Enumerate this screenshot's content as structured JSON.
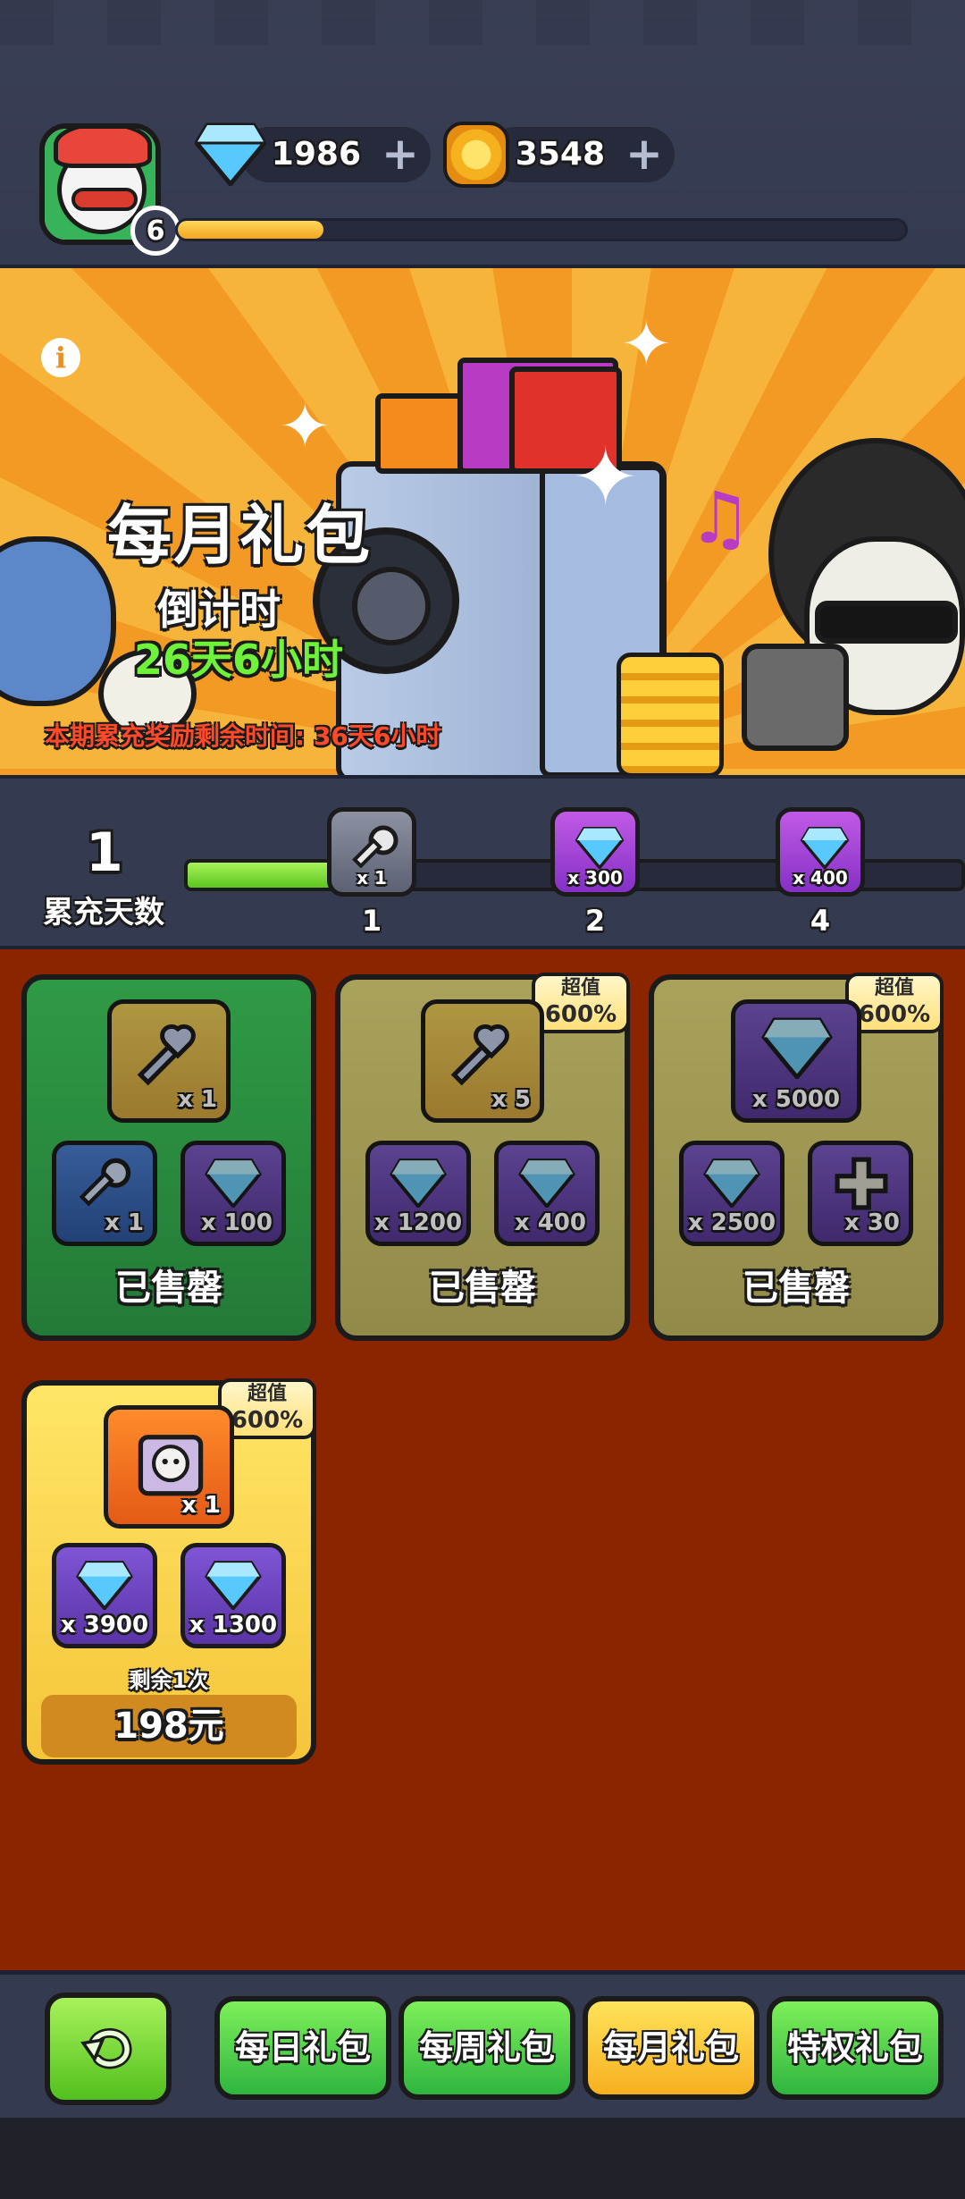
{
  "header": {
    "player_level": "6",
    "xp_progress": 0.2,
    "gems": "1986",
    "coins": "3548"
  },
  "banner": {
    "title": "每月礼包",
    "countdown_label": "倒计时",
    "countdown_value": "26天6小时",
    "period_text": "本期累充奖励剩余时间: 36天6小时"
  },
  "progress": {
    "days": "1",
    "days_label": "累充天数",
    "fill": 0.2,
    "milestones": [
      {
        "reward": "key-icon",
        "qty": "x 1",
        "day": "1"
      },
      {
        "reward": "gem-icon",
        "qty": "x 300",
        "day": "2"
      },
      {
        "reward": "gem-icon",
        "qty": "x 400",
        "day": "4"
      }
    ]
  },
  "packs": [
    {
      "main": {
        "icon": "heart-key-icon",
        "qty": "x 1"
      },
      "sub": [
        {
          "icon": "blue-key-icon",
          "qty": "x 1"
        },
        {
          "icon": "gem-icon",
          "qty": "x 100"
        }
      ],
      "badge": null,
      "status": "已售罄"
    },
    {
      "main": {
        "icon": "heart-key-icon",
        "qty": "x 5"
      },
      "sub": [
        {
          "icon": "gem-icon",
          "qty": "x 1200"
        },
        {
          "icon": "gem-icon",
          "qty": "x 400"
        }
      ],
      "badge": {
        "line1": "超值",
        "line2": "600%"
      },
      "status": "已售罄"
    },
    {
      "main": {
        "icon": "gem-icon",
        "qty": "x 5000"
      },
      "sub": [
        {
          "icon": "gem-icon",
          "qty": "x 2500"
        },
        {
          "icon": "cross-icon",
          "qty": "x 30"
        }
      ],
      "badge": {
        "line1": "超值",
        "line2": "600%"
      },
      "status": "已售罄"
    },
    {
      "main": {
        "icon": "sheep-box-icon",
        "qty": "x 1"
      },
      "sub": [
        {
          "icon": "gem-icon",
          "qty": "x 3900"
        },
        {
          "icon": "gem-icon",
          "qty": "x 1300"
        }
      ],
      "badge": {
        "line1": "超值",
        "line2": "600%"
      },
      "remaining": "剩余1次",
      "price": "198元"
    }
  ],
  "nav": {
    "tabs": [
      {
        "label": "每日礼包"
      },
      {
        "label": "每周礼包"
      },
      {
        "label": "每月礼包",
        "active": true
      },
      {
        "label": "特权礼包"
      }
    ]
  },
  "colors": {
    "accent_gold": "#f7b01f",
    "tab_green": "#2fb53f",
    "pack_area": "#8b2500",
    "countdown_green": "#6ef23a",
    "warning_red": "#ff4a2a"
  }
}
